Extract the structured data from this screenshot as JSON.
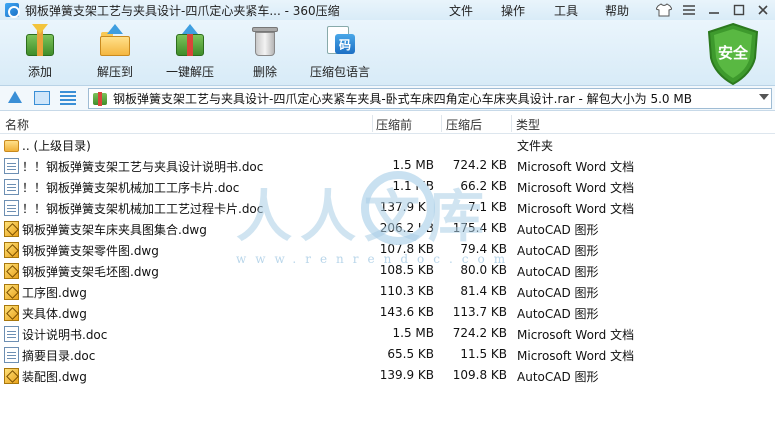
{
  "window": {
    "title": "钢板弹簧支架工艺与夹具设计-四爪定心夹紧车...  - 360压缩",
    "menu": [
      "文件",
      "操作",
      "工具",
      "帮助"
    ]
  },
  "toolbar": {
    "add_label": "添加",
    "extract_to_label": "解压到",
    "one_click_label": "一键解压",
    "delete_label": "删除",
    "lang_label": "压缩包语言",
    "lang_badge": "码",
    "safe_label": "安全"
  },
  "nav": {
    "path": "钢板弹簧支架工艺与夹具设计-四爪定心夹紧车夹具-卧式车床四角定心车床夹具设计.rar - 解包大小为 5.0 MB"
  },
  "columns": {
    "name": "名称",
    "compressed_before": "压缩前",
    "compressed_after": "压缩后",
    "type": "类型"
  },
  "files": [
    {
      "icon": "folder",
      "name": ".. (上级目录)",
      "before": "",
      "after": "",
      "type": "文件夹"
    },
    {
      "icon": "doc",
      "name": "！！钢板弹簧支架工艺与夹具设计说明书.doc",
      "before": "1.5 MB",
      "after": "724.2 KB",
      "type": "Microsoft Word 文档"
    },
    {
      "icon": "doc",
      "name": "！！钢板弹簧支架机械加工工序卡片.doc",
      "before": "1.1 MB",
      "after": "66.2 KB",
      "type": "Microsoft Word 文档"
    },
    {
      "icon": "doc",
      "name": "！！钢板弹簧支架机械加工工艺过程卡片.doc",
      "before": "137.9 KB",
      "after": "7.1 KB",
      "type": "Microsoft Word 文档"
    },
    {
      "icon": "dwg",
      "name": "钢板弹簧支架车床夹具图集合.dwg",
      "before": "206.2 KB",
      "after": "175.4 KB",
      "type": "AutoCAD 图形"
    },
    {
      "icon": "dwg",
      "name": "钢板弹簧支架零件图.dwg",
      "before": "107.8 KB",
      "after": "79.4 KB",
      "type": "AutoCAD 图形"
    },
    {
      "icon": "dwg",
      "name": "钢板弹簧支架毛坯图.dwg",
      "before": "108.5 KB",
      "after": "80.0 KB",
      "type": "AutoCAD 图形"
    },
    {
      "icon": "dwg",
      "name": "工序图.dwg",
      "before": "110.3 KB",
      "after": "81.4 KB",
      "type": "AutoCAD 图形"
    },
    {
      "icon": "dwg",
      "name": "夹具体.dwg",
      "before": "143.6 KB",
      "after": "113.7 KB",
      "type": "AutoCAD 图形"
    },
    {
      "icon": "doc",
      "name": "设计说明书.doc",
      "before": "1.5 MB",
      "after": "724.2 KB",
      "type": "Microsoft Word 文档"
    },
    {
      "icon": "doc",
      "name": "摘要目录.doc",
      "before": "65.5 KB",
      "after": "11.5 KB",
      "type": "Microsoft Word 文档"
    },
    {
      "icon": "dwg",
      "name": "装配图.dwg",
      "before": "139.9 KB",
      "after": "109.8 KB",
      "type": "AutoCAD 图形"
    }
  ],
  "watermark": {
    "text": "人人文库",
    "url": "www.renrendoc.com"
  }
}
